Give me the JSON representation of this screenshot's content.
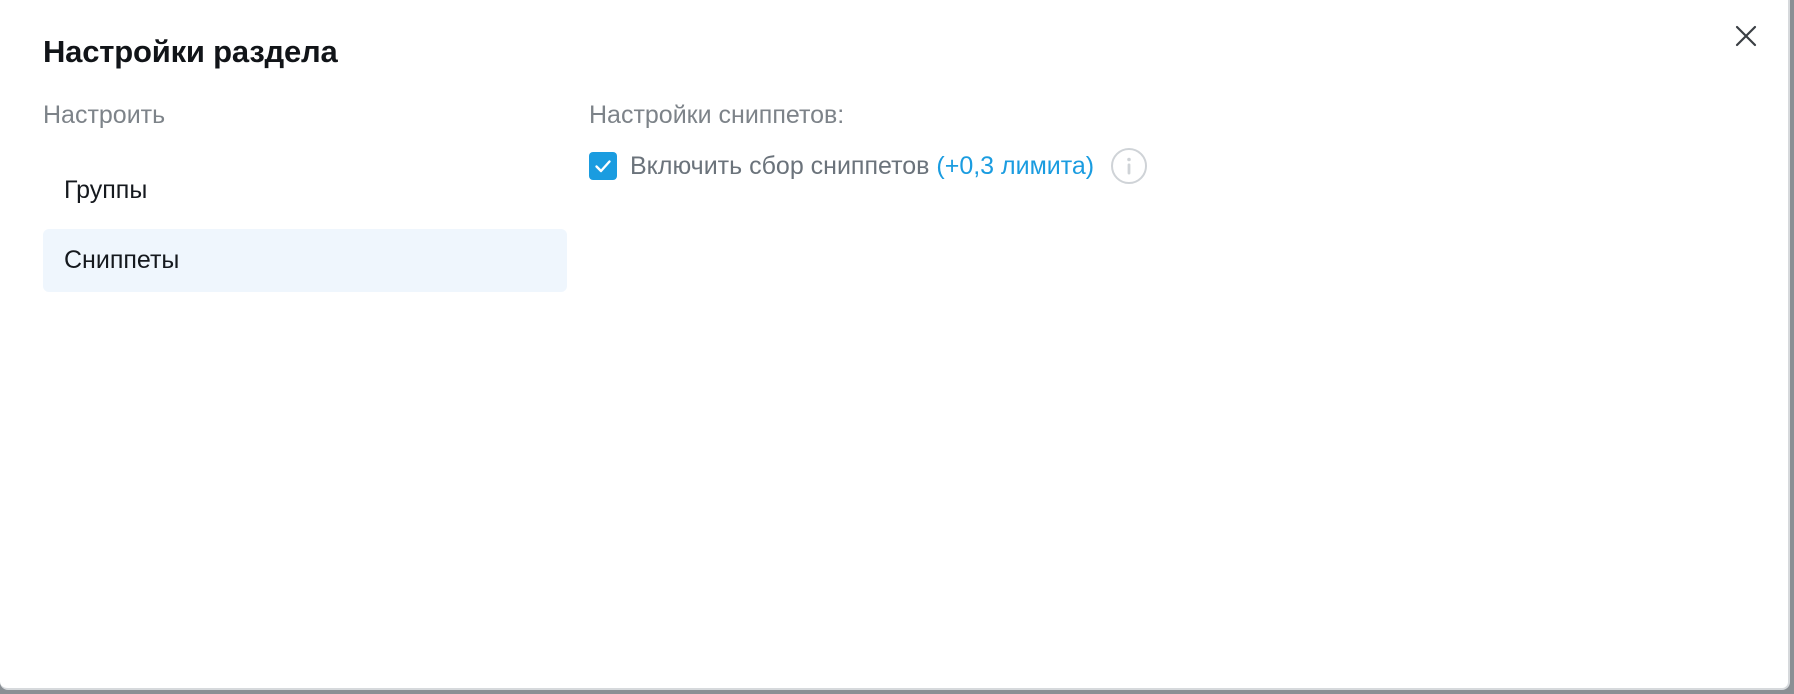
{
  "modal": {
    "title": "Настройки раздела"
  },
  "sidebar": {
    "label": "Настроить",
    "items": [
      {
        "label": "Группы",
        "active": false
      },
      {
        "label": "Сниппеты",
        "active": true
      }
    ]
  },
  "snippets": {
    "heading": "Настройки сниппетов:",
    "option": {
      "label": "Включить сбор сниппетов",
      "limit": "(+0,3 лимита)",
      "checked": true
    }
  },
  "icons": {
    "close": "close-icon",
    "check": "check-icon",
    "info": "info-icon"
  },
  "colors": {
    "accent": "#1a9ce0",
    "active_item_bg": "#eff6fd",
    "muted_text": "#7d8389"
  }
}
